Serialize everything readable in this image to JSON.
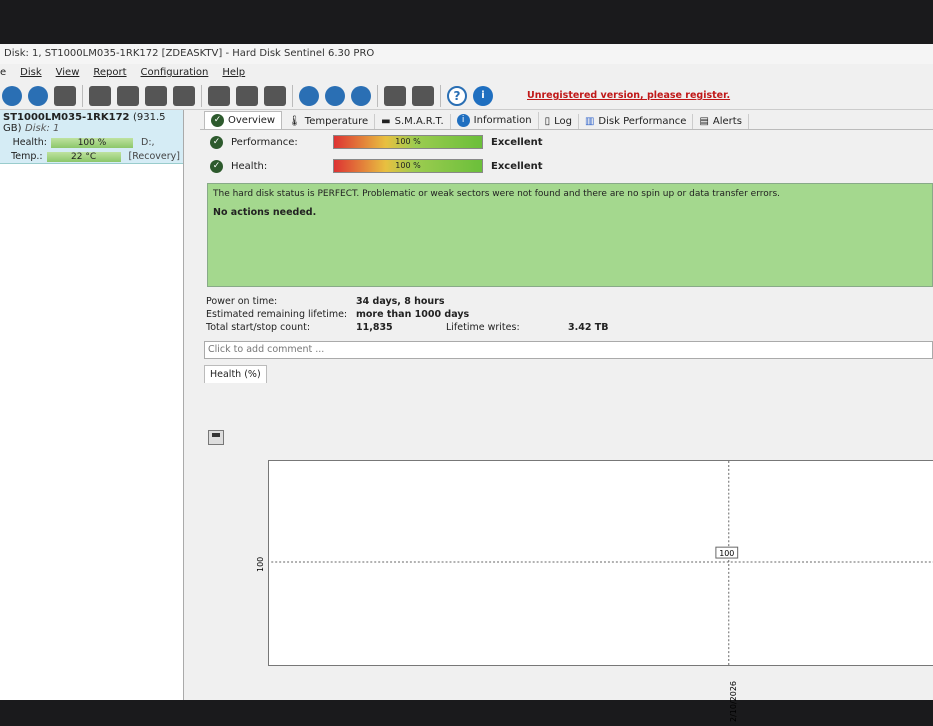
{
  "window": {
    "title": "Disk: 1, ST1000LM035-1RK172 [ZDEASKTV]  -  Hard Disk Sentinel 6.30 PRO"
  },
  "menu": [
    "e",
    "Disk",
    "View",
    "Report",
    "Configuration",
    "Help"
  ],
  "toolbar": {
    "register_notice": "Unregistered version, please register.",
    "help": "?",
    "info": "i"
  },
  "disk": {
    "model": "ST1000LM035-1RK172",
    "size": "(931.5 GB)",
    "disk_label": "Disk: 1",
    "health_label": "Health:",
    "health": "100 %",
    "health_pct": 100,
    "drive": "D:,",
    "temp_label": "Temp.:",
    "temp": "22 °C",
    "partition": "[Recovery]"
  },
  "tabs": [
    "Overview",
    "Temperature",
    "S.M.A.R.T.",
    "Information",
    "Log",
    "Disk Performance",
    "Alerts"
  ],
  "status": {
    "performance_label": "Performance:",
    "performance": "100 %",
    "performance_pct": 100,
    "performance_rating": "Excellent",
    "health_label": "Health:",
    "health": "100 %",
    "health_pct": 100,
    "health_rating": "Excellent"
  },
  "message": {
    "text": "The hard disk status is PERFECT. Problematic or weak sectors were not found and there are no spin up or data transfer errors.",
    "action": "No actions needed."
  },
  "info": {
    "power_on_label": "Power on time:",
    "power_on": "34 days, 8 hours",
    "remaining_label": "Estimated remaining lifetime:",
    "remaining": "more than 1000 days",
    "startstop_label": "Total start/stop count:",
    "startstop": "11,835",
    "writes_label": "Lifetime writes:",
    "writes": "3.42 TB"
  },
  "comment": {
    "placeholder": "Click to add comment ..."
  },
  "chart_data": {
    "type": "line",
    "title": "Health (%)",
    "x": [
      "2/10/2026"
    ],
    "values": [
      100
    ],
    "y_tick": "100",
    "point_label": "100"
  }
}
